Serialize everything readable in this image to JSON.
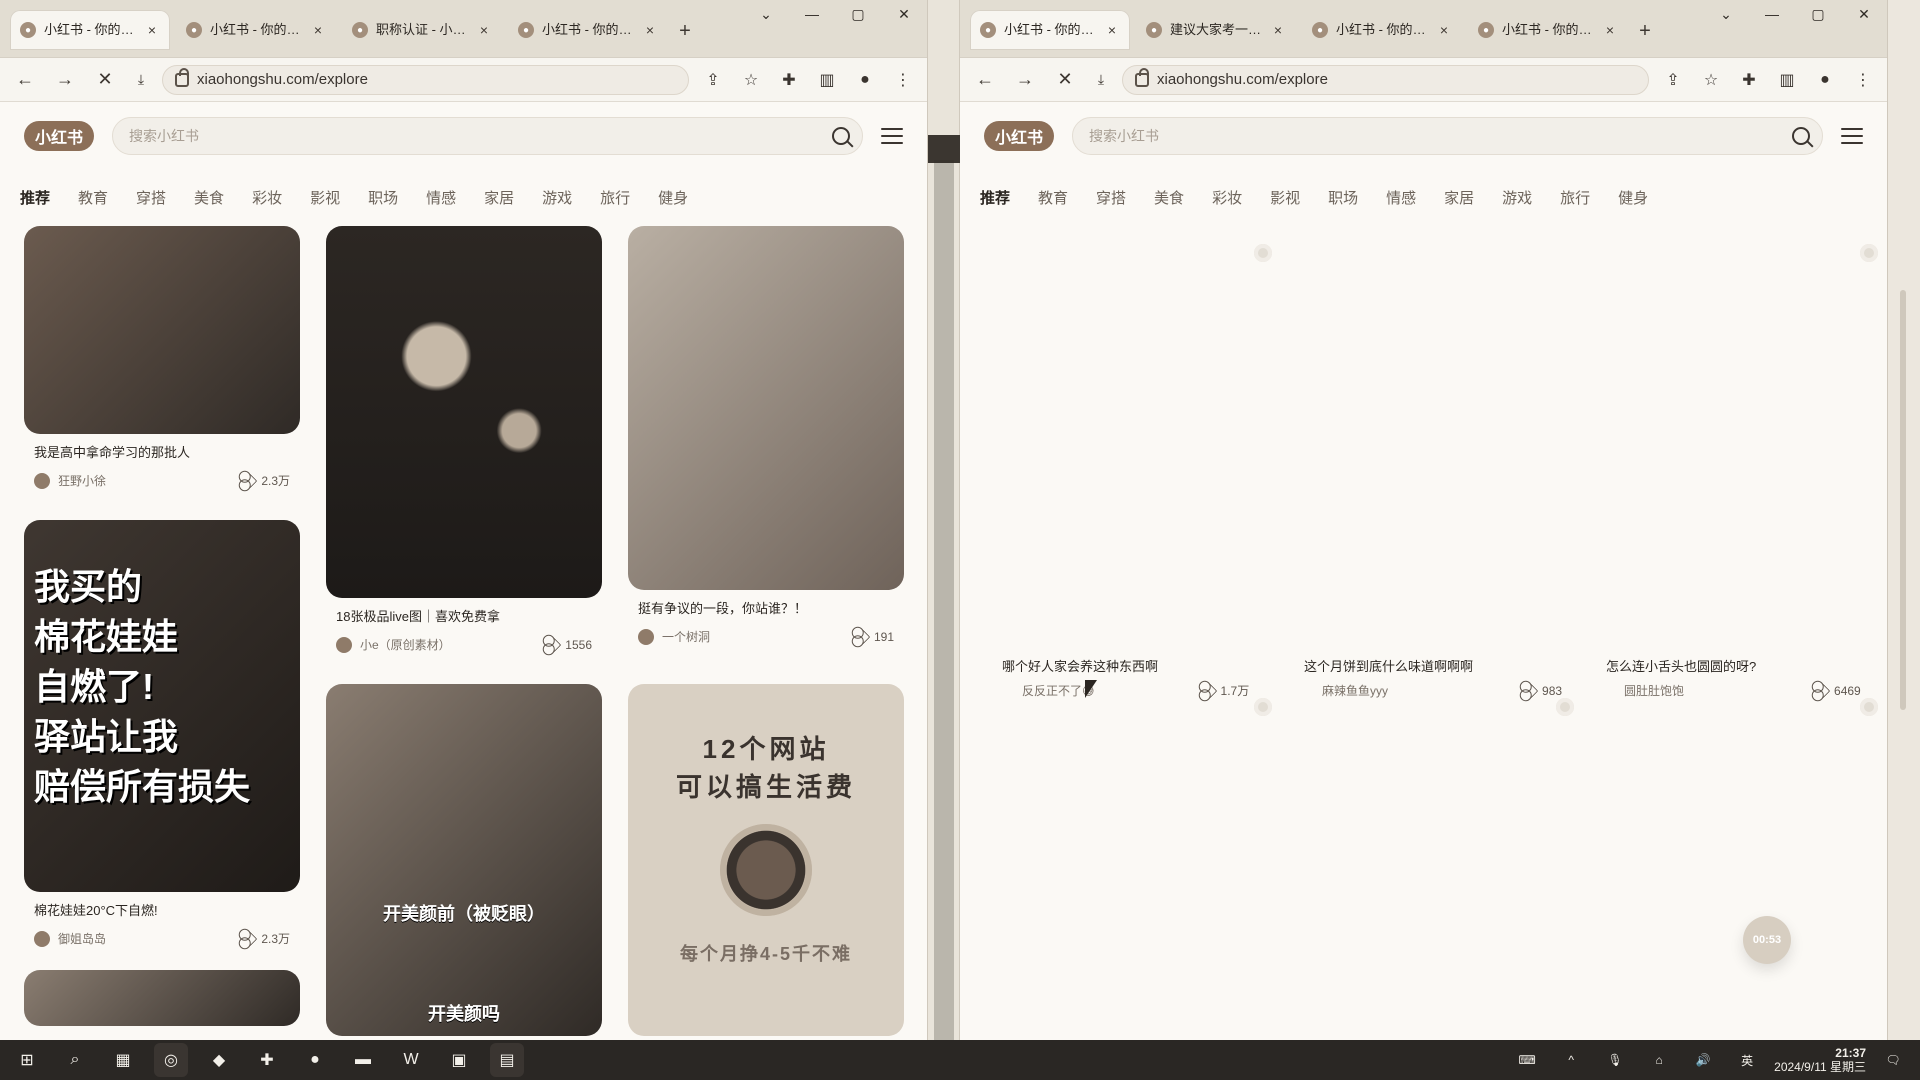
{
  "left": {
    "tabs": [
      {
        "title": "小红书 - 你的生活",
        "active": true
      },
      {
        "title": "小红书 - 你的生活",
        "active": false
      },
      {
        "title": "职称认证 - 小红书",
        "active": false
      },
      {
        "title": "小红书 - 你的生活",
        "active": false
      }
    ],
    "url": "xiaohongshu.com/explore",
    "logo": "小红书",
    "search_placeholder": "搜索小红书",
    "channels": [
      "推荐",
      "教育",
      "穿搭",
      "美食",
      "彩妆",
      "影视",
      "职场",
      "情感",
      "家居",
      "游戏",
      "旅行",
      "健身"
    ],
    "cards": [
      {
        "title": "我是高中拿命学习的那批人",
        "author": "狂野小徐",
        "likes": "2.3万"
      },
      {
        "title": "棉花娃娃20°C下自燃!",
        "author": "御姐岛岛",
        "likes": "2.3万"
      },
      {
        "title": "18张极品live图｜喜欢免费拿",
        "author": "小e（原创素材）",
        "likes": "1556"
      },
      {
        "title": "挺有争议的一段，你站谁？！",
        "author": "一个树洞",
        "likes": "191"
      }
    ],
    "image_texts": {
      "cotton_stack": [
        "我买的",
        "棉花娃娃",
        "自燃了!",
        "驿站让我",
        "赔偿所有损失"
      ],
      "mid_bottom_label_top": "开美颜前（被贬眼）",
      "mid_bottom_label_bottom": "开美颜吗",
      "poster_line1": "12个网站",
      "poster_line2": "可以搞生活费",
      "poster_bottom": "每个月挣4-5千不难"
    }
  },
  "right": {
    "tabs": [
      {
        "title": "小红书 - 你的生活",
        "active": true
      },
      {
        "title": "建议大家考一个职",
        "active": false
      },
      {
        "title": "小红书 - 你的生活",
        "active": false
      },
      {
        "title": "小红书 - 你的生活",
        "active": false
      }
    ],
    "url": "xiaohongshu.com/explore",
    "logo": "小红书",
    "search_placeholder": "搜索小红书",
    "channels": [
      "推荐",
      "教育",
      "穿搭",
      "美食",
      "彩妆",
      "影视",
      "职场",
      "情感",
      "家居",
      "游戏",
      "旅行",
      "健身"
    ],
    "loading_cards": [
      {
        "title": "哪个好人家会养这种东西啊",
        "author": "反反正不了😅",
        "likes": "1.7万"
      },
      {
        "title": "这个月饼到底什么味道啊啊啊",
        "author": "麻辣鱼鱼yyy",
        "likes": "983"
      },
      {
        "title": "怎么连小舌头也圆圆的呀?",
        "author": "圆肚肚饱饱",
        "likes": "6469"
      }
    ],
    "timer": "00:53"
  },
  "taskbar": {
    "time": "21:37",
    "date": "2024/9/11 星期三",
    "ime": "英"
  }
}
